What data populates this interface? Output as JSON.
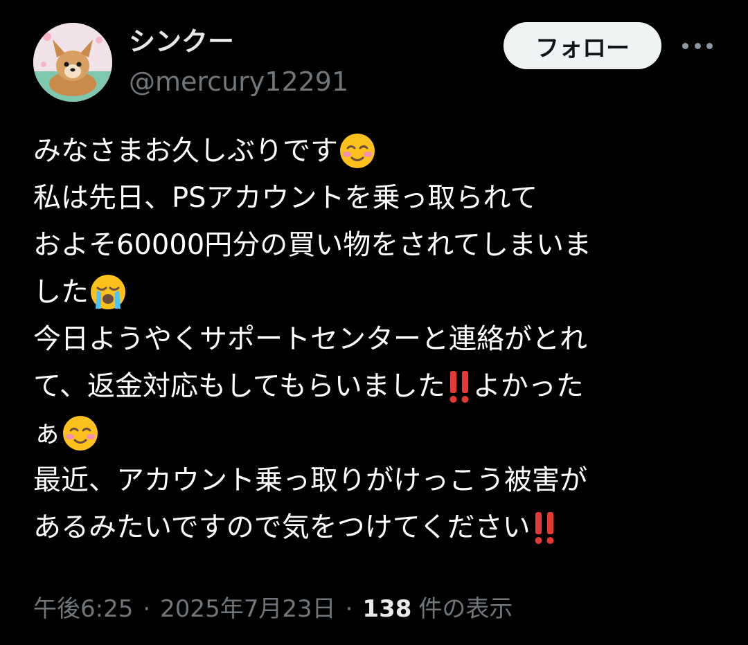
{
  "author": {
    "display_name": "シンクー",
    "handle": "@mercury12291",
    "avatar_icon": "dog-avatar-icon"
  },
  "follow_label": "フォロー",
  "more_icon": "more-horizontal-icon",
  "tweet": {
    "lines": [
      {
        "text": "みなさまお久しぶりです",
        "suffix_icon": "smiling-face-icon"
      },
      {
        "text": "私は先日、PSアカウントを乗っ取られて"
      },
      {
        "text": "およそ60000円分の買い物をされてしまいま"
      },
      {
        "text": "した",
        "suffix_icon": "crying-face-icon"
      },
      {
        "text": "今日ようやくサポートセンターと連絡がとれ"
      },
      {
        "text": "て、返金対応もしてもらいました",
        "mid_icon": "double-exclamation-icon",
        "after_text": "よかった"
      },
      {
        "text": "ぁ",
        "suffix_icon": "smiling-face-icon"
      },
      {
        "text": "最近、アカウント乗っ取りがけっこう被害が"
      },
      {
        "text": "あるみたいですので気をつけてください",
        "suffix_icon": "double-exclamation-icon"
      }
    ]
  },
  "meta": {
    "time": "午後6:25",
    "separator": "·",
    "date": "2025年7月23日",
    "views_count": "138",
    "views_label": "件の表示"
  },
  "colors": {
    "background": "#000000",
    "primary_text": "#e7e9ea",
    "secondary_text": "#71767b",
    "follow_bg": "#eff3f4",
    "emoji_yellow": "#fcc21b",
    "exclamation_red": "#e53935"
  }
}
